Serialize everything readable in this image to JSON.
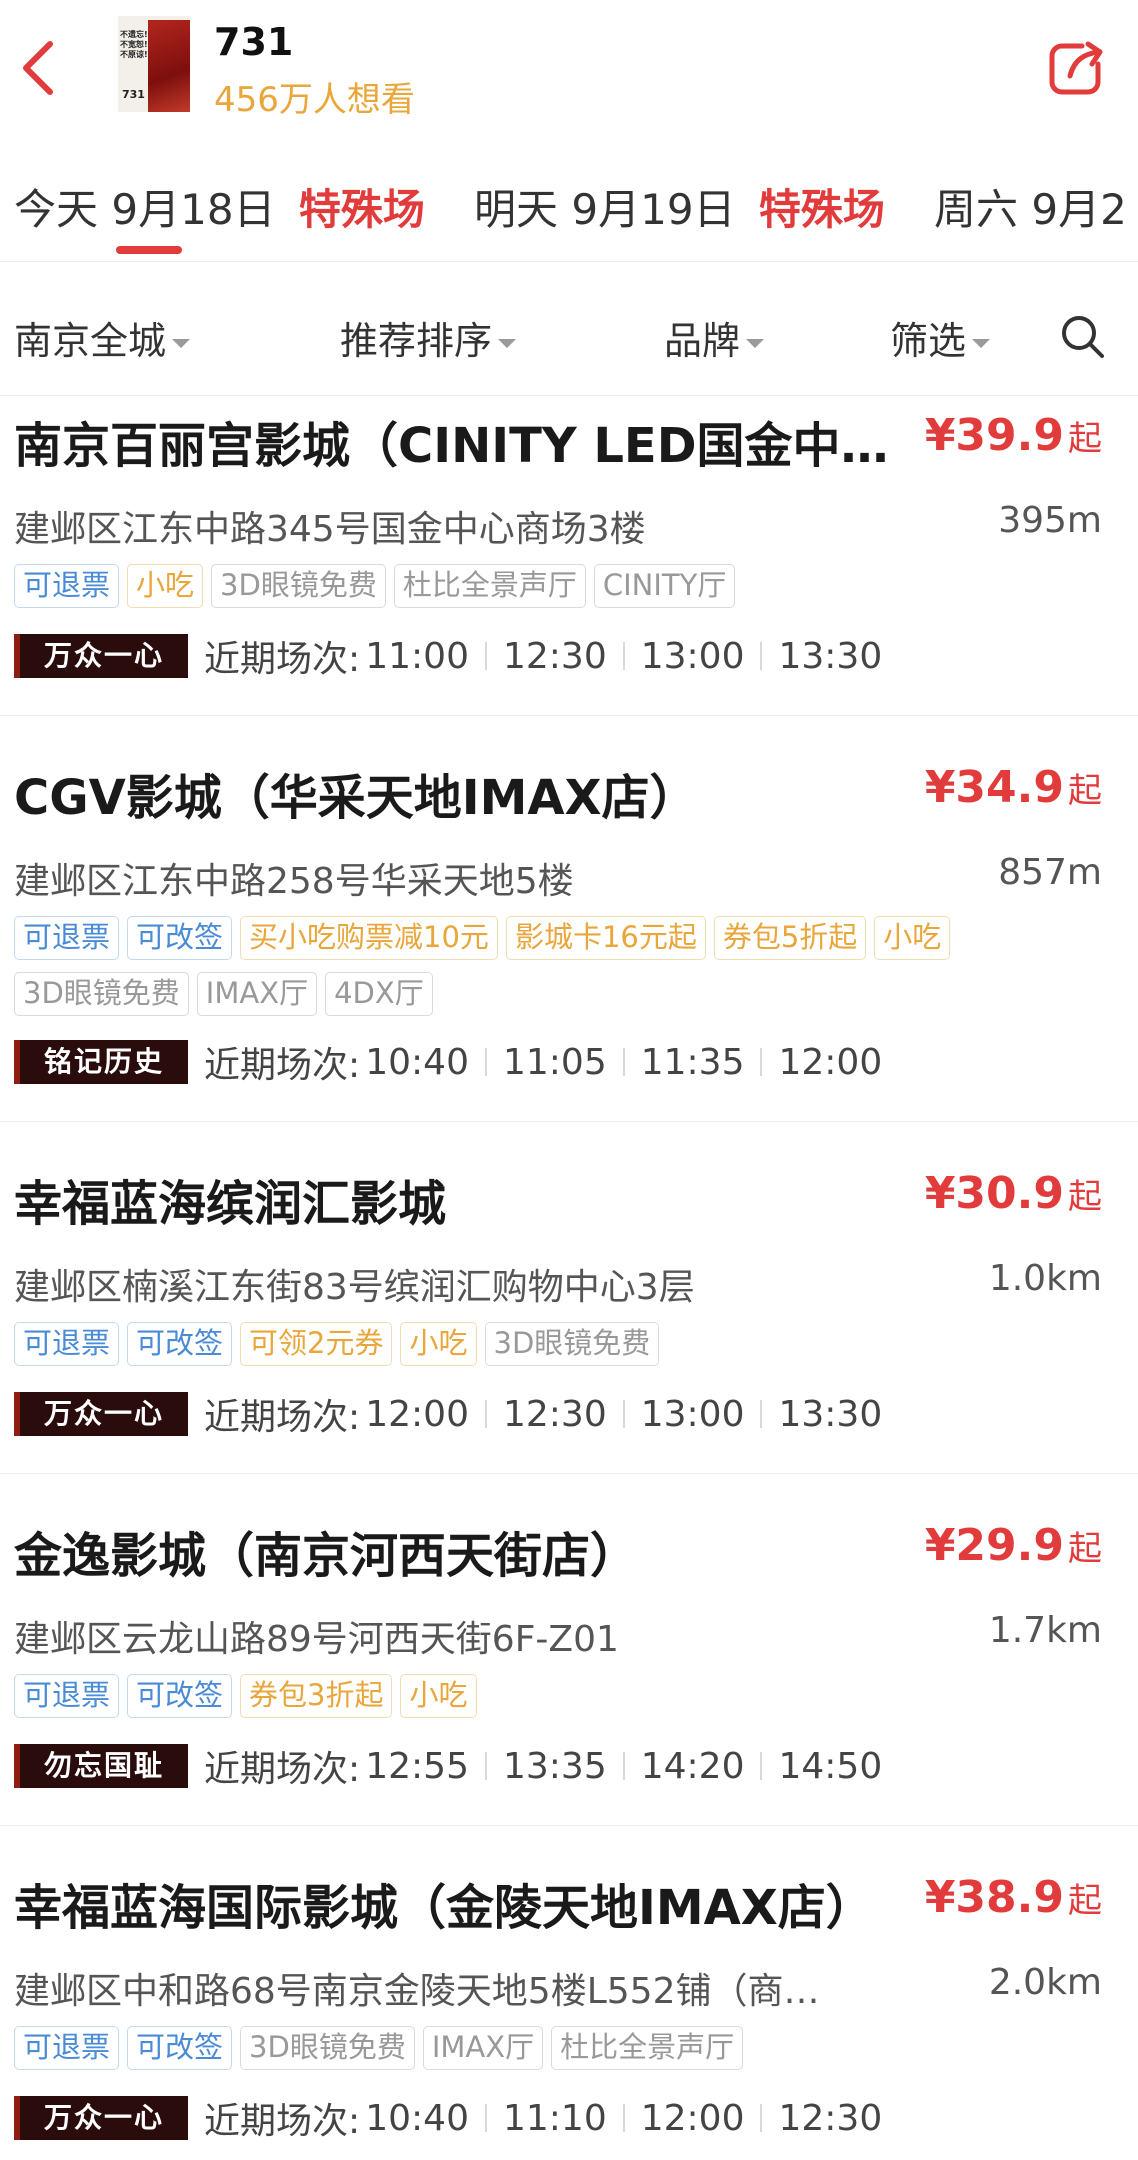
{
  "header": {
    "movie_title": "731",
    "want_count": "456万人想看",
    "poster_lines": [
      "不遗忘!",
      "不宽恕!",
      "不原谅!"
    ],
    "poster_number": "731"
  },
  "date_tabs": [
    {
      "day": "今天",
      "date": "9月18日",
      "tag": "特殊场",
      "selected": true
    },
    {
      "day": "明天",
      "date": "9月19日",
      "tag": "特殊场",
      "selected": false
    },
    {
      "day": "周六",
      "date": "9月2",
      "tag": "",
      "selected": false
    }
  ],
  "filters": {
    "city": "南京全城",
    "sort": "推荐排序",
    "brand": "品牌",
    "filter": "筛选"
  },
  "sessions_label": "近期场次:",
  "colors": {
    "accent": "#e23b3b",
    "orange": "#e9a63a",
    "blue": "#4a8bd6",
    "badge_bg": "#2a0c0c"
  },
  "cinemas": [
    {
      "name": "南京百丽宫影城（CINITY LED国金中…",
      "price": "¥39.9",
      "price_suffix": "起",
      "address": "建邺区江东中路345号国金中心商场3楼",
      "distance": "395m",
      "tags": [
        {
          "text": "可退票",
          "style": "blue"
        },
        {
          "text": "小吃",
          "style": "orange"
        },
        {
          "text": "3D眼镜免费",
          "style": "gray"
        },
        {
          "text": "杜比全景声厅",
          "style": "gray"
        },
        {
          "text": "CINITY厅",
          "style": "gray"
        }
      ],
      "badge": "万众一心",
      "times": [
        "11:00",
        "12:30",
        "13:00",
        "13:30"
      ]
    },
    {
      "name": "CGV影城（华采天地IMAX店）",
      "price": "¥34.9",
      "price_suffix": "起",
      "address": "建邺区江东中路258号华采天地5楼",
      "distance": "857m",
      "tags": [
        {
          "text": "可退票",
          "style": "blue"
        },
        {
          "text": "可改签",
          "style": "blue"
        },
        {
          "text": "买小吃购票减10元",
          "style": "orange"
        },
        {
          "text": "影城卡16元起",
          "style": "orange"
        },
        {
          "text": "券包5折起",
          "style": "orange"
        },
        {
          "text": "小吃",
          "style": "orange"
        }
      ],
      "tags2": [
        {
          "text": "3D眼镜免费",
          "style": "gray"
        },
        {
          "text": "IMAX厅",
          "style": "gray"
        },
        {
          "text": "4DX厅",
          "style": "gray"
        }
      ],
      "badge": "铭记历史",
      "times": [
        "10:40",
        "11:05",
        "11:35",
        "12:00"
      ]
    },
    {
      "name": "幸福蓝海缤润汇影城",
      "price": "¥30.9",
      "price_suffix": "起",
      "address": "建邺区楠溪江东街83号缤润汇购物中心3层",
      "distance": "1.0km",
      "tags": [
        {
          "text": "可退票",
          "style": "blue"
        },
        {
          "text": "可改签",
          "style": "blue"
        },
        {
          "text": "可领2元券",
          "style": "orange"
        },
        {
          "text": "小吃",
          "style": "orange"
        },
        {
          "text": "3D眼镜免费",
          "style": "gray"
        }
      ],
      "badge": "万众一心",
      "times": [
        "12:00",
        "12:30",
        "13:00",
        "13:30"
      ]
    },
    {
      "name": "金逸影城（南京河西天街店）",
      "price": "¥29.9",
      "price_suffix": "起",
      "address": "建邺区云龙山路89号河西天街6F-Z01",
      "distance": "1.7km",
      "tags": [
        {
          "text": "可退票",
          "style": "blue"
        },
        {
          "text": "可改签",
          "style": "blue"
        },
        {
          "text": "券包3折起",
          "style": "orange"
        },
        {
          "text": "小吃",
          "style": "orange"
        }
      ],
      "badge": "勿忘国耻",
      "times": [
        "12:55",
        "13:35",
        "14:20",
        "14:50"
      ]
    },
    {
      "name": "幸福蓝海国际影城（金陵天地IMAX店）",
      "price": "¥38.9",
      "price_suffix": "起",
      "address": "建邺区中和路68号南京金陵天地5楼L552铺（商…",
      "distance": "2.0km",
      "tags": [
        {
          "text": "可退票",
          "style": "blue"
        },
        {
          "text": "可改签",
          "style": "blue"
        },
        {
          "text": "3D眼镜免费",
          "style": "gray"
        },
        {
          "text": "IMAX厅",
          "style": "gray"
        },
        {
          "text": "杜比全景声厅",
          "style": "gray"
        }
      ],
      "badge": "万众一心",
      "times": [
        "10:40",
        "11:10",
        "12:00",
        "12:30"
      ]
    }
  ]
}
